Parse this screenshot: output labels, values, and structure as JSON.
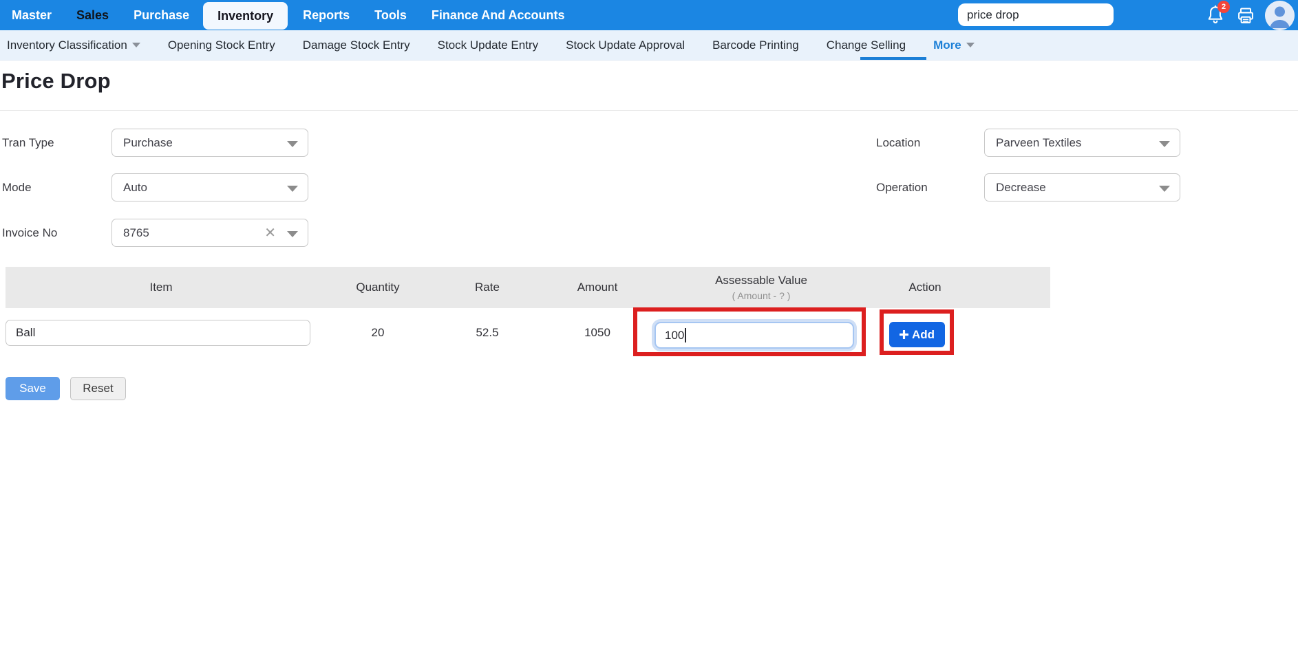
{
  "topnav": {
    "items": [
      {
        "label": "Master"
      },
      {
        "label": "Sales"
      },
      {
        "label": "Purchase"
      },
      {
        "label": "Inventory"
      },
      {
        "label": "Reports"
      },
      {
        "label": "Tools"
      },
      {
        "label": "Finance And Accounts"
      }
    ],
    "active_item": "Inventory",
    "search_value": "price drop",
    "notification_count": "2"
  },
  "subnav": {
    "items": [
      {
        "label": "Inventory Classification"
      },
      {
        "label": "Opening Stock Entry"
      },
      {
        "label": "Damage Stock Entry"
      },
      {
        "label": "Stock Update Entry"
      },
      {
        "label": "Stock Update Approval"
      },
      {
        "label": "Barcode Printing"
      },
      {
        "label": "Change Selling"
      },
      {
        "label": "More"
      }
    ],
    "active_item": "More"
  },
  "page": {
    "title": "Price Drop"
  },
  "form": {
    "tran_type": {
      "label": "Tran Type",
      "value": "Purchase"
    },
    "mode": {
      "label": "Mode",
      "value": "Auto"
    },
    "invoice_no": {
      "label": "Invoice No",
      "value": "8765",
      "clear_icon": "✕"
    },
    "location": {
      "label": "Location",
      "value": "Parveen Textiles"
    },
    "operation": {
      "label": "Operation",
      "value": "Decrease"
    }
  },
  "table": {
    "headers": {
      "item": "Item",
      "quantity": "Quantity",
      "rate": "Rate",
      "amount": "Amount",
      "assessable": "Assessable Value",
      "assessable_sub": "( Amount - ? )",
      "action": "Action"
    },
    "row": {
      "item": "Ball",
      "quantity": "20",
      "rate": "52.5",
      "amount": "1050",
      "assessable_value": "100",
      "add_label": "Add"
    }
  },
  "actions": {
    "save": "Save",
    "reset": "Reset"
  },
  "colors": {
    "topnav_blue": "#1b86e3",
    "subnav_bg": "#e9f2fb",
    "link_blue": "#1b7fd6",
    "add_button_blue": "#1266e3",
    "save_button_blue": "#5f9de9",
    "annotation_red": "#dc1f1f",
    "table_header_gray": "#e9e9e9",
    "badge_red": "#f4453a"
  }
}
